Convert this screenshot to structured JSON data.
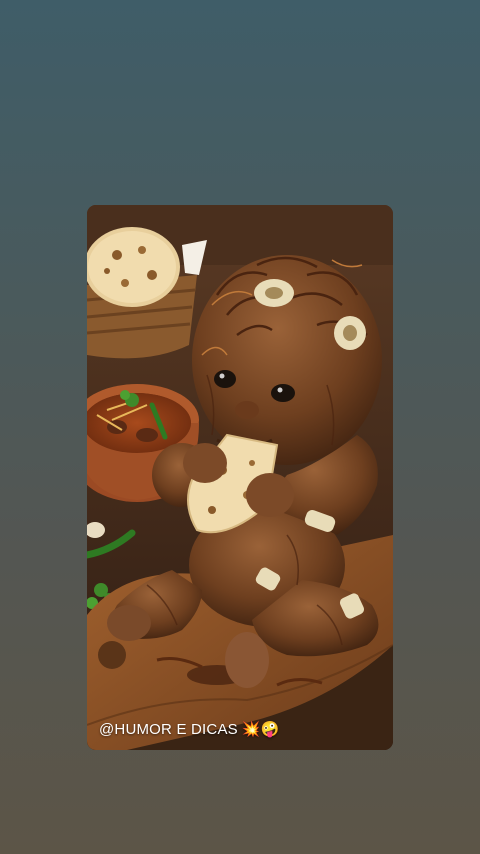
{
  "story": {
    "caption_handle": "@HUMOR E DICAS",
    "caption_emojis": "💥🤪"
  },
  "colors": {
    "background_top": "#3f5d68",
    "background_bottom": "#5c5547"
  }
}
